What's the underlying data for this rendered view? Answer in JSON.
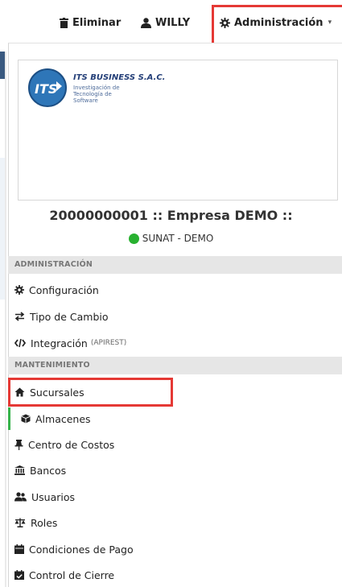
{
  "topbar": {
    "delete_label": "Eliminar",
    "user_label": "WILLY",
    "admin_label": "Administración"
  },
  "logo": {
    "name": "ITS BUSINESS S.A.C.",
    "tagline": "Investigación de Tecnología de Software",
    "mark": "ITS"
  },
  "company": {
    "title": "20000000001 :: Empresa DEMO ::",
    "status": "SUNAT - DEMO",
    "status_color": "#28b130"
  },
  "sections": {
    "admin": "ADMINISTRACIÓN",
    "maint": "MANTENIMIENTO"
  },
  "admin_items": {
    "config": "Configuración",
    "exchange": "Tipo de Cambio",
    "integration": "Integración",
    "integration_note": "(APIREST)"
  },
  "maint_items": {
    "branches": "Sucursales",
    "warehouses": "Almacenes",
    "cost_center": "Centro de Costos",
    "banks": "Bancos",
    "users": "Usuarios",
    "roles": "Roles",
    "payment_terms": "Condiciones de Pago",
    "close_control": "Control de Cierre"
  },
  "colors": {
    "highlight": "#e53935",
    "section_bg": "#e6e6e6"
  }
}
